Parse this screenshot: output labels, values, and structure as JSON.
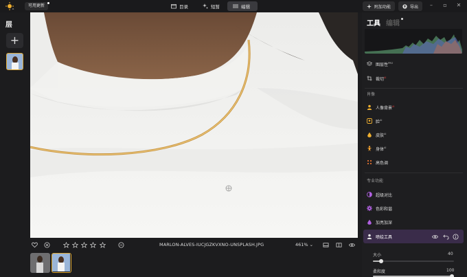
{
  "topbar": {
    "update_label": "可用更新",
    "tabs": [
      {
        "label": "目录",
        "icon": "folder-icon"
      },
      {
        "label": "短暂",
        "icon": "sparkle-icon"
      },
      {
        "label": "编辑",
        "icon": "sliders-icon"
      }
    ],
    "addons_label": "附加功能",
    "export_label": "导出"
  },
  "layers": {
    "title": "层",
    "add_symbol": "+"
  },
  "bottom": {
    "filename": "MARLON-ALVES-IUCJGZKVXNO-UNSPLASH.JPG",
    "zoom": "461%",
    "rating_stars": 5
  },
  "right_panel": {
    "title_tools": "工具",
    "title_edit": "编辑",
    "top_items": [
      {
        "label": "图层性",
        "badge": "PRO",
        "icon": "layers-icon"
      },
      {
        "label": "裁切",
        "badge": "AI",
        "icon": "crop-icon"
      }
    ],
    "section_portrait": "肖像",
    "portrait_items": [
      {
        "label": "人像背景",
        "badge": "AI",
        "icon": "person-icon",
        "color": "#f0b030"
      },
      {
        "label": "脸",
        "badge": "AI",
        "icon": "face-icon",
        "color": "#f0b030"
      },
      {
        "label": "皮肤",
        "badge": "AI",
        "icon": "drop-icon",
        "color": "#f0b030"
      },
      {
        "label": "身体",
        "badge": "AI",
        "icon": "body-icon",
        "color": "#f0a030"
      },
      {
        "label": "高色调",
        "badge": "",
        "icon": "dots-icon",
        "color": "#e07030"
      }
    ],
    "section_pro": "专业功能",
    "pro_items": [
      {
        "label": "超级对比",
        "icon": "contrast-icon",
        "color": "#b060e0"
      },
      {
        "label": "色彩和谐",
        "icon": "gear-icon",
        "color": "#b060e0"
      },
      {
        "label": "加亮加深",
        "icon": "drop-icon",
        "color": "#b060e0"
      }
    ],
    "active_tool": {
      "label": "喷绘工具"
    },
    "sliders": [
      {
        "label": "大小",
        "value": "40",
        "fraction": 0.1
      },
      {
        "label": "柔和度",
        "value": "100",
        "fraction": 1.0
      }
    ]
  },
  "colors": {
    "accent": "#e0a830",
    "pro_purple": "#b060e0",
    "active_bg": "#3a2c4a"
  }
}
